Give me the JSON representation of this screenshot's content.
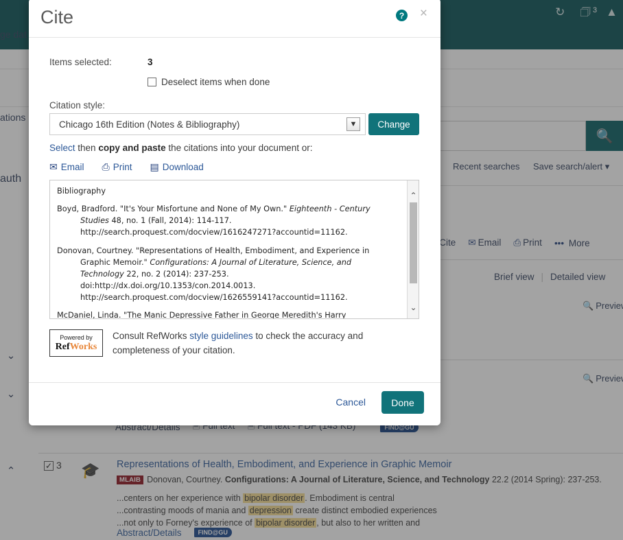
{
  "background": {
    "topbar": {
      "icons": [
        "history-icon",
        "folder-icon",
        "account-icon"
      ],
      "folder_badge": "3"
    },
    "sidebar": {
      "fragments": [
        "ge dat",
        "ations",
        "auth"
      ],
      "chevrons": [
        "chevron-down-icon",
        "chevron-down-icon",
        "chevron-up-icon"
      ]
    },
    "search": {
      "button_icon": "search-icon"
    },
    "search_links": [
      "Recent searches",
      "Save search/alert ▾"
    ],
    "toolbar": [
      "Cite",
      "Email",
      "Print",
      "More"
    ],
    "toolbar_more_prefix": "•••",
    "view_links": {
      "brief": "Brief view",
      "detailed": "Detailed view"
    },
    "preview_label": "Preview",
    "fulltext_row": [
      "Abstract/Details",
      "Full text",
      "Full text - PDF (143 KB)",
      "FIND@GU"
    ],
    "result": {
      "number": "3",
      "checked": "✓",
      "title": "Representations of Health, Embodiment, and Experience in Graphic Memoir",
      "tag": "MLAIB",
      "author": "Donovan, Courtney.",
      "journal": "Configurations: A Journal of Literature, Science, and Technology",
      "citation": "22.2  (2014 Spring): 237-253.",
      "snippets": [
        {
          "pre": "...centers on her experience with ",
          "hl": "bipolar disorder",
          "post": ". Embodiment is central"
        },
        {
          "pre": "...contrasting moods of mania and ",
          "hl": "depression",
          "post": " create distinct embodied experiences"
        },
        {
          "pre": "...not only to Forney's experience of ",
          "hl": "bipolar disorder",
          "post": ", but also to her written and"
        }
      ],
      "footer_link": "Abstract/Details",
      "findgu": "FIND@GU"
    }
  },
  "modal": {
    "title": "Cite",
    "help_icon": "?",
    "close_icon": "×",
    "items_selected_label": "Items selected:",
    "items_selected_count": "3",
    "deselect_label": "Deselect items when done",
    "citation_style_label": "Citation style:",
    "citation_style_value": "Chicago 16th Edition (Notes & Bibliography)",
    "select_arrow_icon": "⌄",
    "change_button": "Change",
    "instruction": {
      "select": "Select",
      "then": " then ",
      "copy_paste": "copy and paste",
      "rest": " the citations into your document or:"
    },
    "actions": [
      {
        "label": "Email",
        "icon": "envelope-icon",
        "glyph": "✉"
      },
      {
        "label": "Print",
        "icon": "printer-icon",
        "glyph": "⎙"
      },
      {
        "label": "Download",
        "icon": "download-icon",
        "glyph": "▤"
      }
    ],
    "bibliography": {
      "heading": "Bibliography",
      "entries": [
        {
          "line1_pre": "Boyd, Bradford. \"It's Your Misfortune and None of My Own.\" ",
          "line1_italic": "Eighteenth - Century",
          "line2_italic": "Studies",
          "line2_post": " 48, no. 1 (Fall, 2014): 114-117.",
          "line3": "http://search.proquest.com/docview/1616247271?accountid=11162."
        },
        {
          "line1_pre": "Donovan, Courtney. \"Representations of Health, Embodiment, and Experience in",
          "line2_pre": "Graphic Memoir.\" ",
          "line2_italic": "Configurations: A Journal of Literature, Science, and",
          "line3_italic": "Technology",
          "line3_post": " 22, no. 2 (2014): 237-253.",
          "line4": "doi:http://dx.doi.org/10.1353/con.2014.0013.",
          "line5": "http://search.proquest.com/docview/1626559141?accountid=11162."
        },
        {
          "line1": "McDaniel, Linda. \"The Manic Depressive Father in George Meredith's Harry"
        }
      ],
      "scroll_up_icon": "⌃",
      "scroll_down_icon": "⌄"
    },
    "refworks": {
      "powered_by": "Powered by",
      "name_first": "Ref",
      "name_second": "Works",
      "text_pre": "Consult RefWorks ",
      "link": "style guidelines",
      "text_post": " to check the accuracy and completeness of your citation."
    },
    "cancel_button": "Cancel",
    "done_button": "Done",
    "accent_color": "#11737a",
    "link_color": "#2b5797"
  }
}
